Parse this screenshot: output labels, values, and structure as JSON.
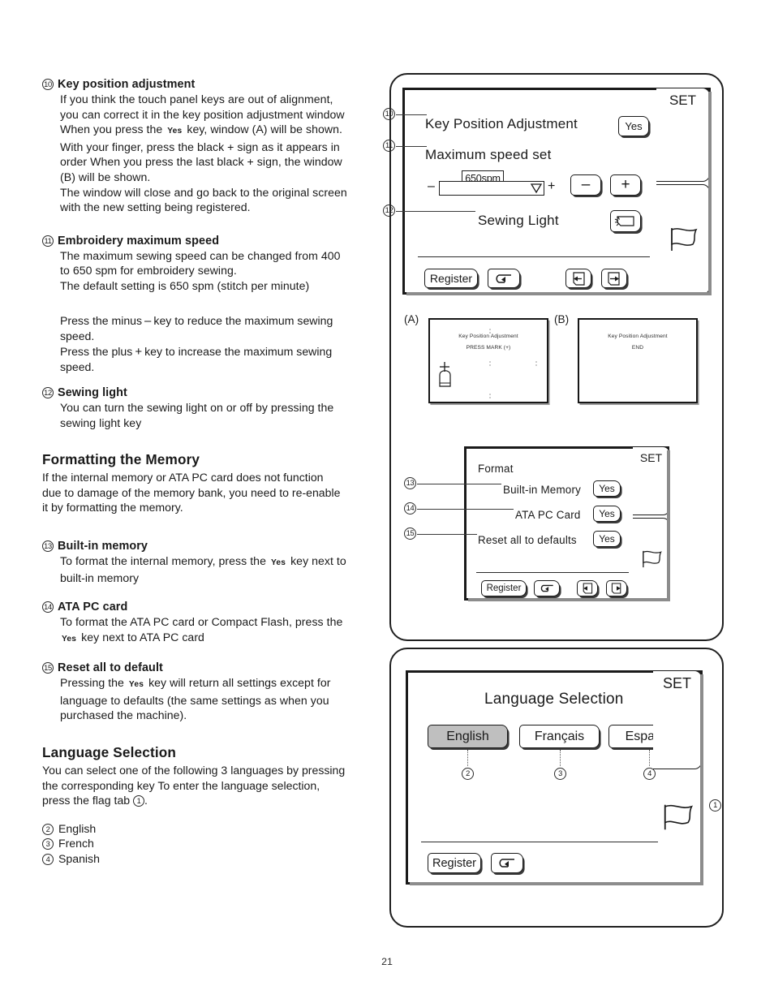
{
  "page": {
    "number": "21"
  },
  "left_column": {
    "items": [
      {
        "num": "10",
        "title": "Key position adjustment",
        "lines": [
          "If you think the touch panel keys are out of alignment,",
          "you can correct it in the key position adjustment window",
          "When you press the ",
          " key, window (A) will be shown.",
          "With your finger, press the black + sign as it appears in",
          "order When you press the last black + sign, the window",
          "(B) will be shown.",
          "The window will close and go back to the original screen",
          "with the new setting being registered."
        ],
        "inline_key": "Yes"
      },
      {
        "num": "11",
        "title": "Embroidery maximum speed",
        "lines": [
          "The maximum sewing speed can be changed from 400",
          "to 650 spm for embroidery sewing.",
          "The default setting is 650 spm (stitch per minute)"
        ]
      }
    ],
    "minus_para": {
      "before": "Press the minus",
      "symbol": "–",
      "after": "key to reduce the maximum sewing",
      "second_line": "speed."
    },
    "plus_para": {
      "before": "Press the plus",
      "symbol": "+",
      "after": "key to increase the maximum sewing",
      "second_line": "speed."
    },
    "sewing_light": {
      "num": "12",
      "title": "Sewing light",
      "lines": [
        "You can turn the sewing light on or off by pressing the",
        "sewing light key"
      ]
    },
    "formatting": {
      "title": "Formatting the Memory",
      "lines": [
        "If the internal memory or ATA PC card does not function",
        "due to damage of the memory bank, you need to re-enable",
        "it by formatting the memory."
      ]
    },
    "built_in": {
      "num": "13",
      "title": "Built-in memory",
      "line1a": "To format the internal memory, press the",
      "inline_key": "Yes",
      "line1b": "key next to",
      "line2": "built-in memory"
    },
    "ata_card": {
      "num": "14",
      "title": "ATA PC card",
      "line1": "To format the ATA PC card or Compact Flash, press the",
      "inline_key": "Yes",
      "line2b": "key next to ATA PC card"
    },
    "reset_all": {
      "num": "15",
      "title": "Reset all to default",
      "line1a": "Pressing the",
      "inline_key": "Yes",
      "line1b": "key will return all settings except for",
      "line2": "language to defaults (the same settings as when you",
      "line3": "purchased the machine)."
    },
    "language_selection": {
      "title": "Language Selection",
      "lines": [
        "You can select one of the following 3 languages by pressing",
        "the corresponding key To enter the language selection,",
        "press the flag tab"
      ],
      "flag_tab_num": "1",
      "trailing": ".",
      "list": [
        {
          "num": "2",
          "label": "English"
        },
        {
          "num": "3",
          "label": "French"
        },
        {
          "num": "4",
          "label": "Spanish"
        }
      ]
    }
  },
  "panel_settings": {
    "callouts": [
      "10",
      "11",
      "12"
    ],
    "row_key_position": {
      "label": "Key Position Adjustment",
      "key": "Yes"
    },
    "row_max_speed": {
      "label": "Maximum speed set"
    },
    "speed": {
      "value": "650spm",
      "minus": "–",
      "plus": "+",
      "minus_key": "–",
      "plus_key": "+"
    },
    "row_sewing_light": {
      "label": "Sewing Light",
      "icon": "sewing-light-icon"
    },
    "set_tab": "SET",
    "flag_tab": "flag-icon",
    "footer": {
      "register": "Register",
      "back": "return-arrow-icon",
      "prev": "page-left-icon",
      "next": "page-right-icon"
    }
  },
  "sub_windows": {
    "a": {
      "label": "(A)",
      "title": "Key Position Adjustment",
      "body": "PRESS MARK (+)"
    },
    "b": {
      "label": "(B)",
      "title": "Key Position Adjustment",
      "body": "END"
    }
  },
  "panel_format": {
    "title": "Format",
    "callouts": [
      "13",
      "14",
      "15"
    ],
    "rows": [
      {
        "label": "Built-in Memory",
        "key": "Yes"
      },
      {
        "label": "ATA PC Card",
        "key": "Yes"
      },
      {
        "label": "Reset all to defaults",
        "key": "Yes"
      }
    ],
    "set_tab": "SET",
    "footer": {
      "register": "Register",
      "back": "return-arrow-icon",
      "prev": "page-left-icon",
      "next": "page-right-icon"
    }
  },
  "panel_language": {
    "title": "Language Selection",
    "options": [
      {
        "label": "English",
        "num": "2",
        "selected": true
      },
      {
        "label": "Français",
        "num": "3",
        "selected": false
      },
      {
        "label": "Español",
        "num": "4",
        "selected": false
      }
    ],
    "set_tab": "SET",
    "flag_callout": "1",
    "footer": {
      "register": "Register",
      "back": "return-arrow-icon"
    }
  }
}
